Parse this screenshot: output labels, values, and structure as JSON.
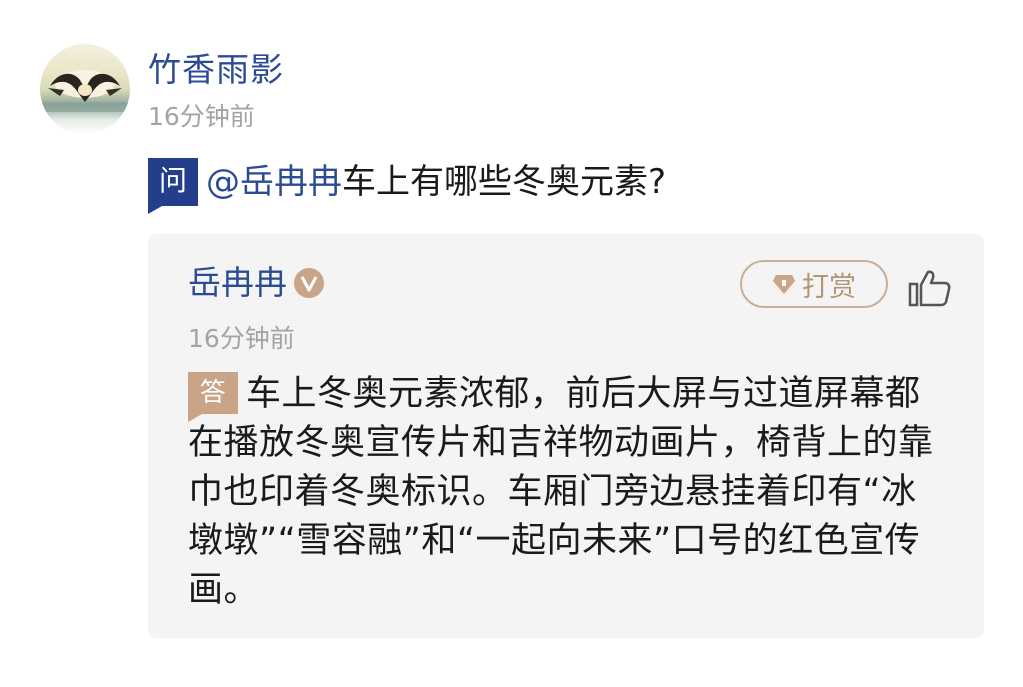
{
  "question_post": {
    "author": "竹香雨影",
    "time": "16分钟前",
    "badge": "问",
    "mention": "@岳冉冉",
    "text": "车上有哪些冬奥元素?"
  },
  "answer_post": {
    "author": "岳冉冉",
    "time": "16分钟前",
    "badge": "答",
    "tip_label": "打赏",
    "text": "车上冬奥元素浓郁，前后大屏与过道屏幕都在播放冬奥宣传片和吉祥物动画片，椅背上的靠巾也印着冬奥标识。车厢门旁边悬挂着印有“冰墩墩”“雪容融”和“一起向未来”口号的红色宣传画。"
  },
  "icons": {
    "verified": "verified-v-icon",
    "tip": "diamond-tip-icon",
    "like": "thumbs-up-icon"
  },
  "colors": {
    "link_blue": "#2b4b93",
    "question_badge": "#233f8c",
    "answer_badge": "#c9a487",
    "tip_border": "#c8b199",
    "meta_gray": "#a3a3a3",
    "card_bg": "#f4f4f4"
  }
}
